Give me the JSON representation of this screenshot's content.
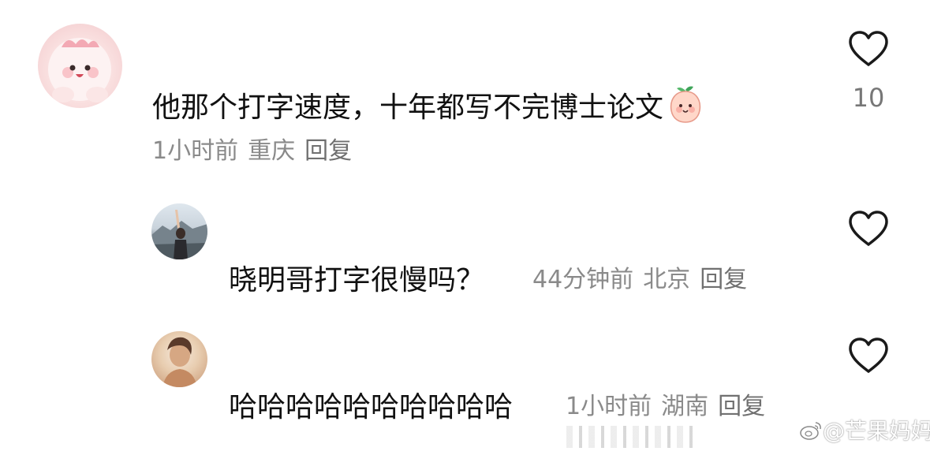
{
  "comment": {
    "text": "他那个打字速度，十年都写不完博士论文",
    "emoji": "peach-emoji",
    "time": "1小时前",
    "location": "重庆",
    "reply_label": "回复",
    "like_count": "10",
    "avatar": "cartoon-pink-avatar"
  },
  "replies": [
    {
      "text": "晓明哥打字很慢吗？",
      "time": "44分钟前",
      "location": "北京",
      "reply_label": "回复",
      "avatar": "photo-avatar-mountain"
    },
    {
      "text": "哈哈哈哈哈哈哈哈哈哈",
      "time": "1小时前",
      "location": "湖南",
      "reply_label": "回复",
      "avatar": "photo-avatar-portrait"
    }
  ],
  "watermark": {
    "text": "@芒果妈妈",
    "logo": "weibo-logo"
  },
  "colors": {
    "primary_text": "#111111",
    "meta_text": "#8a8a8a",
    "like_icon": "#1a1a1a",
    "background": "#ffffff"
  }
}
